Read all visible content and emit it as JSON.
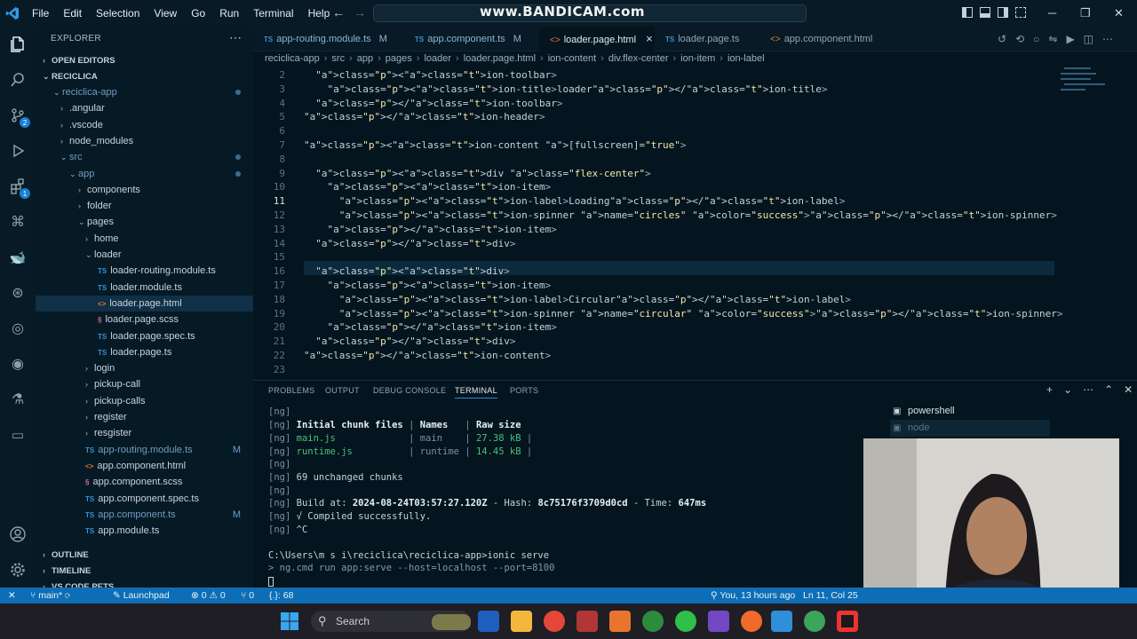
{
  "menu": [
    "File",
    "Edit",
    "Selection",
    "View",
    "Go",
    "Run",
    "Terminal",
    "Help"
  ],
  "watermark": "www.BANDICAM.com",
  "explorer": {
    "title": "EXPLORER",
    "open_editors": "OPEN EDITORS",
    "root": "RECICLICA",
    "items": [
      {
        "label": "reciclica-app"
      },
      {
        "label": ".angular"
      },
      {
        "label": ".vscode"
      },
      {
        "label": "node_modules"
      },
      {
        "label": "src"
      },
      {
        "label": "app"
      },
      {
        "label": "components"
      },
      {
        "label": "folder"
      },
      {
        "label": "pages"
      },
      {
        "label": "home"
      },
      {
        "label": "loader"
      },
      {
        "label": "loader-routing.module.ts",
        "prefix": "TS"
      },
      {
        "label": "loader.module.ts",
        "prefix": "TS"
      },
      {
        "label": "loader.page.html",
        "prefix": "<>"
      },
      {
        "label": "loader.page.scss",
        "prefix": "§"
      },
      {
        "label": "loader.page.spec.ts",
        "prefix": "TS"
      },
      {
        "label": "loader.page.ts",
        "prefix": "TS"
      },
      {
        "label": "login"
      },
      {
        "label": "pickup-call"
      },
      {
        "label": "pickup-calls"
      },
      {
        "label": "register"
      },
      {
        "label": "resgister"
      },
      {
        "label": "app-routing.module.ts",
        "prefix": "TS",
        "badge": "M"
      },
      {
        "label": "app.component.html",
        "prefix": "<>"
      },
      {
        "label": "app.component.scss",
        "prefix": "§"
      },
      {
        "label": "app.component.spec.ts",
        "prefix": "TS"
      },
      {
        "label": "app.component.ts",
        "prefix": "TS",
        "badge": "M"
      },
      {
        "label": "app.module.ts",
        "prefix": "TS"
      }
    ],
    "outline": "OUTLINE",
    "timeline": "TIMELINE",
    "vscode_pets": "VS CODE PETS"
  },
  "tabs": [
    {
      "label": "app-routing.module.ts",
      "badge": "M"
    },
    {
      "label": "app.component.ts",
      "badge": "M"
    },
    {
      "label": "loader.page.html",
      "close": "×"
    },
    {
      "label": "loader.page.ts"
    },
    {
      "label": "app.component.html"
    }
  ],
  "breadcrumb": [
    "reciclica-app",
    "src",
    "app",
    "pages",
    "loader",
    "loader.page.html",
    "ion-content",
    "div.flex-center",
    "ion-item",
    "ion-label"
  ],
  "editor": {
    "line_numbers": [
      "2",
      "3",
      "4",
      "5",
      "6",
      "7",
      "8",
      "9",
      "10",
      "11",
      "12",
      "13",
      "14",
      "15",
      "16",
      "17",
      "18",
      "19",
      "20",
      "21",
      "22",
      "23"
    ],
    "lines": [
      "  <ion-toolbar>",
      "    <ion-title>loader</ion-title>",
      "  </ion-toolbar>",
      "</ion-header>",
      "",
      "<ion-content [fullscreen]=\"true\">",
      "",
      "  <div class=\"flex-center\">",
      "    <ion-item>",
      "      <ion-label>Loading</ion-label>",
      "      <ion-spinner name=\"circles\" color=\"success\"></ion-spinner>",
      "    </ion-item>",
      "  </div>",
      "",
      "  <div>",
      "    <ion-item>",
      "      <ion-label>Circular</ion-label>",
      "      <ion-spinner name=\"circular\" color=\"success\"></ion-spinner>",
      "    </ion-item>",
      "  </div>",
      "</ion-content>",
      ""
    ]
  },
  "panel": {
    "tabs": [
      "PROBLEMS",
      "OUTPUT",
      "DEBUG CONSOLE",
      "TERMINAL",
      "PORTS"
    ],
    "terminals": [
      "powershell",
      "node"
    ]
  },
  "terminal": {
    "ng": "[ng]",
    "hdr_files": "Initial chunk files",
    "hdr_names": "Names",
    "hdr_size": "Raw size",
    "rows": [
      {
        "file": "main.js",
        "name": "main",
        "size": "27.38 kB"
      },
      {
        "file": "runtime.js",
        "name": "runtime",
        "size": "14.45 kB"
      }
    ],
    "unchanged": "69 unchanged chunks",
    "build_prefix": "Build at: ",
    "build_time": "2024-08-24T03:57:27.120Z",
    "hash_prefix": " - Hash: ",
    "hash": "8c75176f3709d0cd",
    "time_prefix": " - Time: ",
    "time": "647ms",
    "compiled": "√ Compiled successfully.",
    "ctrlc": "^C",
    "prompt": "C:\\Users\\m s i\\reciclica\\reciclica-app>ionic serve",
    "cmd": "> ng.cmd run app:serve --host=localhost --port=8100"
  },
  "status": {
    "branch": "main*",
    "launchpad": "Launchpad",
    "errors": "0",
    "warnings": "0",
    "ports": "0",
    "selection": "{.}: 68",
    "blame": "You, 13 hours ago",
    "position": "Ln 11, Col 25"
  },
  "taskbar": {
    "search": "Search"
  }
}
